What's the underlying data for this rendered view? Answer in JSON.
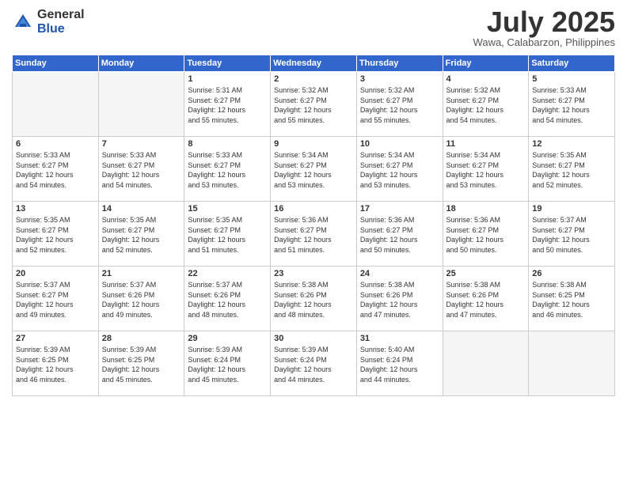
{
  "logo": {
    "general": "General",
    "blue": "Blue"
  },
  "title": "July 2025",
  "location": "Wawa, Calabarzon, Philippines",
  "days_of_week": [
    "Sunday",
    "Monday",
    "Tuesday",
    "Wednesday",
    "Thursday",
    "Friday",
    "Saturday"
  ],
  "weeks": [
    [
      {
        "day": "",
        "info": ""
      },
      {
        "day": "",
        "info": ""
      },
      {
        "day": "1",
        "info": "Sunrise: 5:31 AM\nSunset: 6:27 PM\nDaylight: 12 hours\nand 55 minutes."
      },
      {
        "day": "2",
        "info": "Sunrise: 5:32 AM\nSunset: 6:27 PM\nDaylight: 12 hours\nand 55 minutes."
      },
      {
        "day": "3",
        "info": "Sunrise: 5:32 AM\nSunset: 6:27 PM\nDaylight: 12 hours\nand 55 minutes."
      },
      {
        "day": "4",
        "info": "Sunrise: 5:32 AM\nSunset: 6:27 PM\nDaylight: 12 hours\nand 54 minutes."
      },
      {
        "day": "5",
        "info": "Sunrise: 5:33 AM\nSunset: 6:27 PM\nDaylight: 12 hours\nand 54 minutes."
      }
    ],
    [
      {
        "day": "6",
        "info": "Sunrise: 5:33 AM\nSunset: 6:27 PM\nDaylight: 12 hours\nand 54 minutes."
      },
      {
        "day": "7",
        "info": "Sunrise: 5:33 AM\nSunset: 6:27 PM\nDaylight: 12 hours\nand 54 minutes."
      },
      {
        "day": "8",
        "info": "Sunrise: 5:33 AM\nSunset: 6:27 PM\nDaylight: 12 hours\nand 53 minutes."
      },
      {
        "day": "9",
        "info": "Sunrise: 5:34 AM\nSunset: 6:27 PM\nDaylight: 12 hours\nand 53 minutes."
      },
      {
        "day": "10",
        "info": "Sunrise: 5:34 AM\nSunset: 6:27 PM\nDaylight: 12 hours\nand 53 minutes."
      },
      {
        "day": "11",
        "info": "Sunrise: 5:34 AM\nSunset: 6:27 PM\nDaylight: 12 hours\nand 53 minutes."
      },
      {
        "day": "12",
        "info": "Sunrise: 5:35 AM\nSunset: 6:27 PM\nDaylight: 12 hours\nand 52 minutes."
      }
    ],
    [
      {
        "day": "13",
        "info": "Sunrise: 5:35 AM\nSunset: 6:27 PM\nDaylight: 12 hours\nand 52 minutes."
      },
      {
        "day": "14",
        "info": "Sunrise: 5:35 AM\nSunset: 6:27 PM\nDaylight: 12 hours\nand 52 minutes."
      },
      {
        "day": "15",
        "info": "Sunrise: 5:35 AM\nSunset: 6:27 PM\nDaylight: 12 hours\nand 51 minutes."
      },
      {
        "day": "16",
        "info": "Sunrise: 5:36 AM\nSunset: 6:27 PM\nDaylight: 12 hours\nand 51 minutes."
      },
      {
        "day": "17",
        "info": "Sunrise: 5:36 AM\nSunset: 6:27 PM\nDaylight: 12 hours\nand 50 minutes."
      },
      {
        "day": "18",
        "info": "Sunrise: 5:36 AM\nSunset: 6:27 PM\nDaylight: 12 hours\nand 50 minutes."
      },
      {
        "day": "19",
        "info": "Sunrise: 5:37 AM\nSunset: 6:27 PM\nDaylight: 12 hours\nand 50 minutes."
      }
    ],
    [
      {
        "day": "20",
        "info": "Sunrise: 5:37 AM\nSunset: 6:27 PM\nDaylight: 12 hours\nand 49 minutes."
      },
      {
        "day": "21",
        "info": "Sunrise: 5:37 AM\nSunset: 6:26 PM\nDaylight: 12 hours\nand 49 minutes."
      },
      {
        "day": "22",
        "info": "Sunrise: 5:37 AM\nSunset: 6:26 PM\nDaylight: 12 hours\nand 48 minutes."
      },
      {
        "day": "23",
        "info": "Sunrise: 5:38 AM\nSunset: 6:26 PM\nDaylight: 12 hours\nand 48 minutes."
      },
      {
        "day": "24",
        "info": "Sunrise: 5:38 AM\nSunset: 6:26 PM\nDaylight: 12 hours\nand 47 minutes."
      },
      {
        "day": "25",
        "info": "Sunrise: 5:38 AM\nSunset: 6:26 PM\nDaylight: 12 hours\nand 47 minutes."
      },
      {
        "day": "26",
        "info": "Sunrise: 5:38 AM\nSunset: 6:25 PM\nDaylight: 12 hours\nand 46 minutes."
      }
    ],
    [
      {
        "day": "27",
        "info": "Sunrise: 5:39 AM\nSunset: 6:25 PM\nDaylight: 12 hours\nand 46 minutes."
      },
      {
        "day": "28",
        "info": "Sunrise: 5:39 AM\nSunset: 6:25 PM\nDaylight: 12 hours\nand 45 minutes."
      },
      {
        "day": "29",
        "info": "Sunrise: 5:39 AM\nSunset: 6:24 PM\nDaylight: 12 hours\nand 45 minutes."
      },
      {
        "day": "30",
        "info": "Sunrise: 5:39 AM\nSunset: 6:24 PM\nDaylight: 12 hours\nand 44 minutes."
      },
      {
        "day": "31",
        "info": "Sunrise: 5:40 AM\nSunset: 6:24 PM\nDaylight: 12 hours\nand 44 minutes."
      },
      {
        "day": "",
        "info": ""
      },
      {
        "day": "",
        "info": ""
      }
    ]
  ]
}
